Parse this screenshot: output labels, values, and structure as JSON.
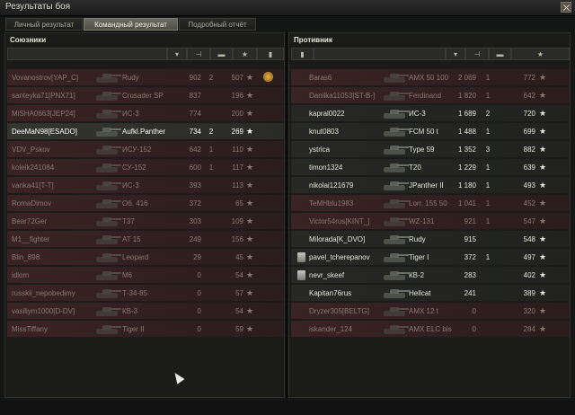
{
  "window": {
    "title": "Результаты боя"
  },
  "tabs": [
    {
      "label": "Личный результат",
      "active": false
    },
    {
      "label": "Командный результат",
      "active": true
    },
    {
      "label": "Подробный отчёт",
      "active": false
    }
  ],
  "allies": {
    "title": "Союзники",
    "rows": [
      {
        "player": "Vovanostrov[YAP_C]",
        "tank": "Rudy",
        "damage": "902",
        "kills": "2",
        "xp": "507",
        "state": "dead",
        "medal": true
      },
      {
        "player": "santeyka71[PNX71]",
        "tank": "Crusader SP",
        "damage": "837",
        "kills": "",
        "xp": "196",
        "state": "dead"
      },
      {
        "player": "MiSHA0663[JEP24]",
        "tank": "ИС-3",
        "damage": "774",
        "kills": "",
        "xp": "200",
        "state": "dead"
      },
      {
        "player": "DeeMaN98[ESADO]",
        "tank": "Aufkl.Panther",
        "damage": "734",
        "kills": "2",
        "xp": "269",
        "state": "me"
      },
      {
        "player": "VDV_Pskov",
        "tank": "ИСУ-152",
        "damage": "642",
        "kills": "1",
        "xp": "110",
        "state": "dead"
      },
      {
        "player": "koleik241084",
        "tank": "СУ-152",
        "damage": "600",
        "kills": "1",
        "xp": "117",
        "state": "dead"
      },
      {
        "player": "vanka41[T-T]",
        "tank": "ИС-3",
        "damage": "393",
        "kills": "",
        "xp": "113",
        "state": "dead"
      },
      {
        "player": "RomaDimov",
        "tank": "Об. 416",
        "damage": "372",
        "kills": "",
        "xp": "65",
        "state": "dead"
      },
      {
        "player": "Bear72Ger",
        "tank": "T37",
        "damage": "303",
        "kills": "",
        "xp": "109",
        "state": "dead"
      },
      {
        "player": "M1__fighter",
        "tank": "AT 15",
        "damage": "249",
        "kills": "",
        "xp": "156",
        "state": "dead"
      },
      {
        "player": "Blin_898",
        "tank": "Leopard",
        "damage": "29",
        "kills": "",
        "xp": "45",
        "state": "dead"
      },
      {
        "player": "idlom",
        "tank": "M6",
        "damage": "0",
        "kills": "",
        "xp": "54",
        "state": "dead"
      },
      {
        "player": "russkii_nepobedimy",
        "tank": "Т-34-85",
        "damage": "0",
        "kills": "",
        "xp": "57",
        "state": "dead"
      },
      {
        "player": "vasiliym1000[D-DV]",
        "tank": "КВ-3",
        "damage": "0",
        "kills": "",
        "xp": "54",
        "state": "dead"
      },
      {
        "player": "MissTiffany",
        "tank": "Tiger II",
        "damage": "0",
        "kills": "",
        "xp": "59",
        "state": "dead"
      }
    ]
  },
  "enemies": {
    "title": "Противник",
    "rows": [
      {
        "player": "Baras6",
        "tank": "AMX 50 100",
        "damage": "2 069",
        "kills": "1",
        "xp": "772",
        "state": "dead"
      },
      {
        "player": "Danilka11053[ST-B-]",
        "tank": "Ferdinand",
        "damage": "1 820",
        "kills": "1",
        "xp": "642",
        "state": "dead"
      },
      {
        "player": "kapral0022",
        "tank": "ИС-3",
        "damage": "1 689",
        "kills": "2",
        "xp": "720",
        "state": "alive"
      },
      {
        "player": "knut0803",
        "tank": "FCM 50 t",
        "damage": "1 488",
        "kills": "1",
        "xp": "699",
        "state": "alive"
      },
      {
        "player": "ystrica",
        "tank": "Type 59",
        "damage": "1 352",
        "kills": "3",
        "xp": "882",
        "state": "alive"
      },
      {
        "player": "timon1324",
        "tank": "T20",
        "damage": "1 229",
        "kills": "1",
        "xp": "639",
        "state": "alive"
      },
      {
        "player": "nikolai121679",
        "tank": "JPanther II",
        "damage": "1 180",
        "kills": "1",
        "xp": "493",
        "state": "alive"
      },
      {
        "player": "TeMHblu1983",
        "tank": "Lorr. 155 50",
        "damage": "1 041",
        "kills": "1",
        "xp": "452",
        "state": "dead"
      },
      {
        "player": "Victor54rus[KINT_]",
        "tank": "WZ-131",
        "damage": "921",
        "kills": "1",
        "xp": "547",
        "state": "dead"
      },
      {
        "player": "Milorada[K_DVO]",
        "tank": "Rudy",
        "damage": "915",
        "kills": "",
        "xp": "548",
        "state": "alive"
      },
      {
        "player": "pavel_tcherepanov",
        "tank": "Tiger I",
        "damage": "372",
        "kills": "1",
        "xp": "497",
        "state": "alive",
        "award": true
      },
      {
        "player": "nevr_skeef",
        "tank": "КВ-2",
        "damage": "283",
        "kills": "",
        "xp": "402",
        "state": "alive",
        "award": true
      },
      {
        "player": "Kapitan76rus",
        "tank": "Hellcat",
        "damage": "241",
        "kills": "",
        "xp": "389",
        "state": "alive"
      },
      {
        "player": "Dryzer305[BELTG]",
        "tank": "AMX 12 t",
        "damage": "0",
        "kills": "",
        "xp": "320",
        "state": "dead"
      },
      {
        "player": "iskander_124",
        "tank": "AMX ELC bis",
        "damage": "0",
        "kills": "",
        "xp": "284",
        "state": "dead"
      }
    ]
  }
}
